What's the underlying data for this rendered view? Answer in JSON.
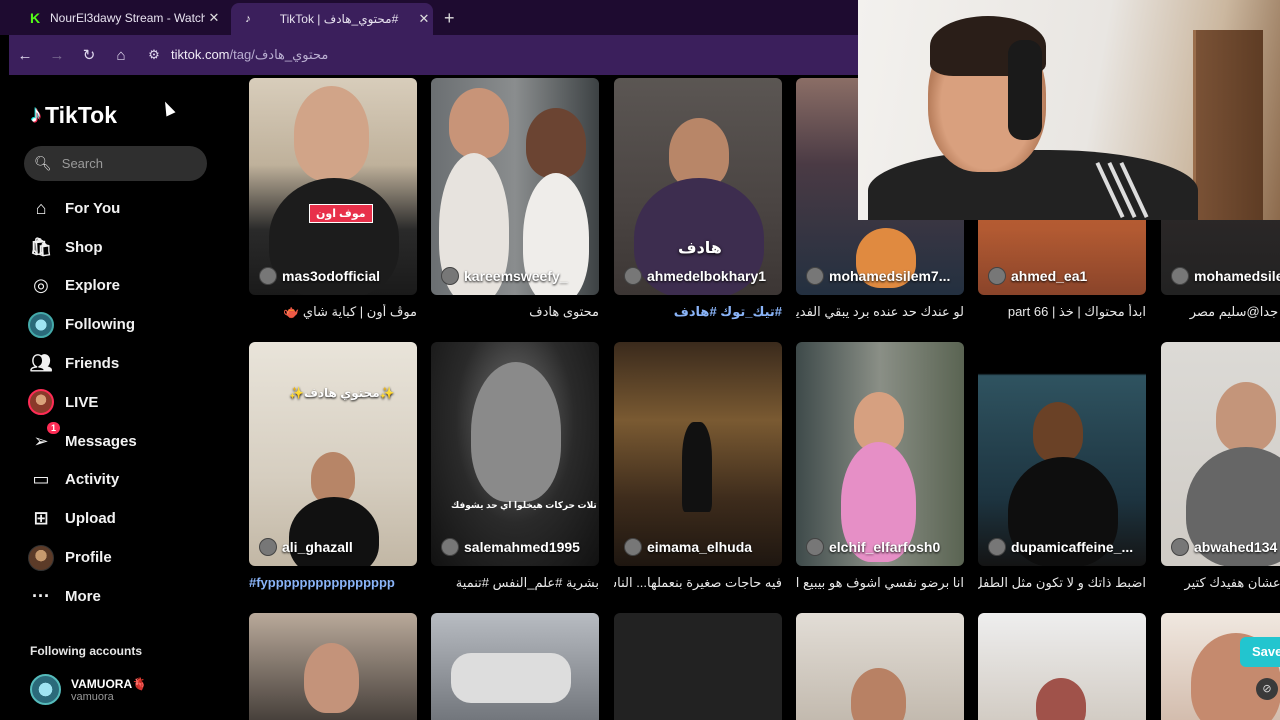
{
  "browser": {
    "tabs": [
      {
        "title": "NourEl3dawy Stream - Watch L",
        "favicon": "K",
        "active": false
      },
      {
        "title": "TikTok | محتوي_هادف#",
        "favicon": "♪",
        "active": true
      }
    ],
    "url_domain": "tiktok.com",
    "url_path": "/tag/محتوي_هادف"
  },
  "sidebar": {
    "logo": "TikTok",
    "search_placeholder": "Search",
    "items": [
      {
        "label": "For You",
        "icon": "home-icon"
      },
      {
        "label": "Shop",
        "icon": "shop-bag-icon"
      },
      {
        "label": "Explore",
        "icon": "compass-icon"
      },
      {
        "label": "Following",
        "icon": "avatar"
      },
      {
        "label": "Friends",
        "icon": "friends-icon"
      },
      {
        "label": "LIVE",
        "icon": "avatar"
      },
      {
        "label": "Messages",
        "icon": "send-icon",
        "badge": "1"
      },
      {
        "label": "Activity",
        "icon": "inbox-icon"
      },
      {
        "label": "Upload",
        "icon": "plus-square-icon"
      },
      {
        "label": "Profile",
        "icon": "avatar"
      },
      {
        "label": "More",
        "icon": "more-icon"
      }
    ],
    "following_header": "Following accounts",
    "following_accounts": [
      {
        "name": "VAMUORA🫀",
        "handle": "vamuora"
      }
    ]
  },
  "videos": [
    {
      "author": "mas3odofficial",
      "caption": "موڤ أون | كباية شاي 🫖",
      "caption_style": "text"
    },
    {
      "author": "kareemsweefy_",
      "caption": "محتوى هادف",
      "caption_style": "text"
    },
    {
      "author": "ahmedelbokhary1",
      "caption": "#تيك_توك #هادف",
      "caption_style": "tag"
    },
    {
      "author": "mohamedsilem7...",
      "caption": "لو عندك حد عنده برد يبقي الفديو ده",
      "caption_style": "text"
    },
    {
      "author": "ahmed_ea1",
      "caption": "ابدأ محتواك | خذ | part 66",
      "caption_style": "text"
    },
    {
      "author": "mohamedsilem",
      "caption": "كلام مهم جدا@سليم مصر",
      "caption_style": "text"
    },
    {
      "author": "ali_ghazall",
      "caption": "#fypppppppppppppppp",
      "caption_style": "tagltr"
    },
    {
      "author": "salemahmed1995",
      "caption": "بشرية #علم_النفس #تنمية",
      "caption_style": "text"
    },
    {
      "author": "eimama_elhuda",
      "caption": "فيه حاجات صغيرة بنعملها... الناس",
      "caption_style": "text"
    },
    {
      "author": "elchif_elfarfosh0",
      "caption": "انا برضو نفسي اشوف هو بيبيع ايه",
      "caption_style": "text"
    },
    {
      "author": "dupamicaffeine_...",
      "caption": "اضبط ذاتك و لا تكون مثل الطفل",
      "caption_style": "text"
    },
    {
      "author": "abwahed134",
      "caption": "ن الفولو عشان هفيدك كتير",
      "caption_style": "text"
    }
  ],
  "overlays": {
    "move_on_label": "موف اون",
    "hadef_text": "هادف",
    "muhtawa_text": "✨محتوي هادف✨",
    "three_moves_text": "تلات حركات هيخلوا اي حد يشوفك"
  },
  "save_button": "Save"
}
